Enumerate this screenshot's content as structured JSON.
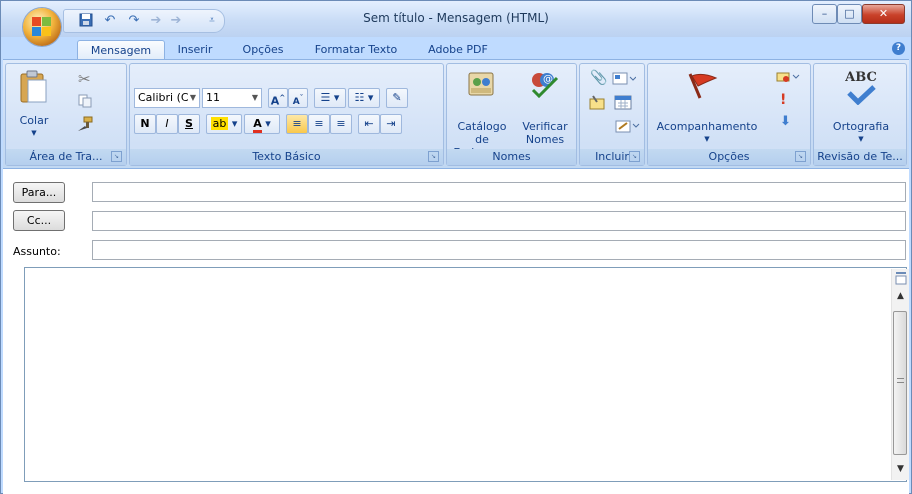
{
  "window": {
    "title": "Sem título - Mensagem (HTML)",
    "minimize": "–",
    "maximize": "□",
    "close": "✕",
    "help": "?"
  },
  "qat": {
    "save_icon": "save-icon",
    "undo_icon": "undo-icon",
    "redo_icon": "redo-icon",
    "prev_icon": "up-arrow-icon",
    "next_icon": "down-arrow-icon",
    "customize_icon": "customize-icon"
  },
  "tabs": [
    {
      "label": "Mensagem",
      "active": true
    },
    {
      "label": "Inserir"
    },
    {
      "label": "Opções"
    },
    {
      "label": "Formatar Texto"
    },
    {
      "label": "Adobe PDF"
    }
  ],
  "ribbon": {
    "clipboard": {
      "label": "Área de Tra...",
      "paste": "Colar"
    },
    "basic_text": {
      "label": "Texto Básico",
      "font": "Calibri (C",
      "size": "11",
      "bold": "N",
      "italic": "I",
      "underline": "S"
    },
    "names": {
      "label": "Nomes",
      "address_book_line1": "Catálogo de",
      "address_book_line2": "Endereços",
      "check_names_line1": "Verificar",
      "check_names_line2": "Nomes"
    },
    "include": {
      "label": "Incluir"
    },
    "options": {
      "label": "Opções",
      "follow_up": "Acompanhamento"
    },
    "proofing": {
      "label": "Revisão de Te...",
      "spelling": "Ortografia",
      "abc": "ABC"
    }
  },
  "form": {
    "to_button": "Para...",
    "cc_button": "Cc...",
    "subject_label": "Assunto:",
    "to_value": "",
    "cc_value": "",
    "subject_value": ""
  },
  "colors": {
    "ribbon_bg": "#c7dbf5",
    "accent": "#15428b",
    "highlight": "#ffe000",
    "font_color": "#e03020"
  }
}
